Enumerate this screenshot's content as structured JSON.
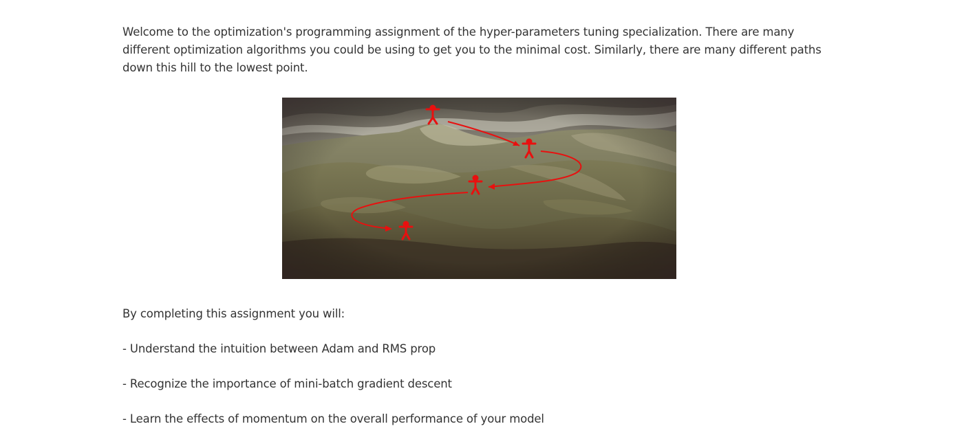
{
  "intro": "Welcome to the optimization's programming assignment of the hyper-parameters tuning specialization. There are many different optimization algorithms you could be using to get you to the minimal cost. Similarly, there are many different paths down this hill to the lowest point.",
  "figure": {
    "subject": "hill-descent-illustration",
    "accent_color": "#e8100f"
  },
  "outcomes_intro": "By completing this assignment you will:",
  "outcomes": [
    "- Understand the intuition between Adam and RMS prop",
    "- Recognize the importance of mini-batch gradient descent",
    "- Learn the effects of momentum on the overall performance of your model"
  ]
}
